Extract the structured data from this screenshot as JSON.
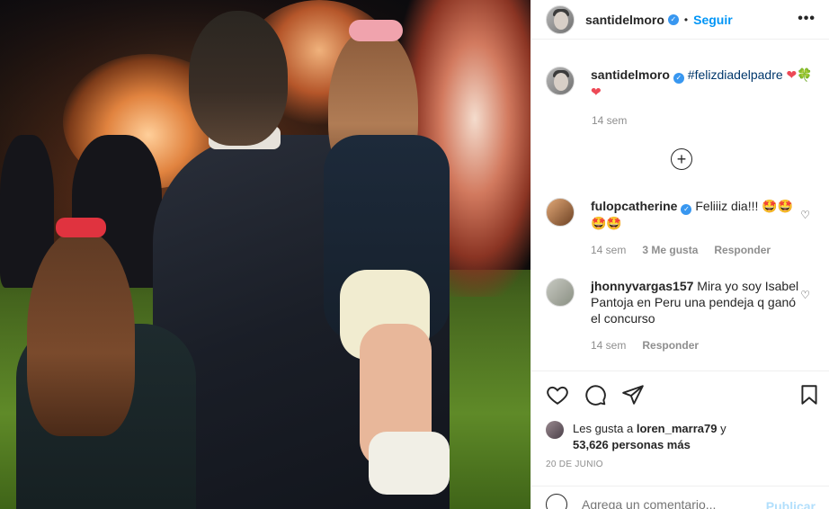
{
  "header": {
    "username": "santidelmoro",
    "separator": "•",
    "follow_label": "Seguir",
    "more_label": "•••"
  },
  "caption": {
    "username": "santidelmoro",
    "hashtag": "#felizdiadelpadre",
    "emoji_1": "❤",
    "emoji_2": "🍀",
    "emoji_3": "❤",
    "time": "14 sem"
  },
  "load_more": {
    "icon": "plus-circle-icon",
    "symbol": "+"
  },
  "comments": [
    {
      "username": "fulopcatherine",
      "text": "Feliiiz dia!!! 🤩🤩 🤩🤩",
      "time": "14 sem",
      "likes": "3 Me gusta",
      "reply": "Responder"
    },
    {
      "username": "jhonnyvargas157",
      "text": "Mira yo soy Isabel Pantoja en Peru una pendeja q ganó el concurso",
      "time": "14 sem",
      "reply": "Responder"
    }
  ],
  "likes": {
    "prefix": "Les gusta a ",
    "user": "loren_marra79",
    "middle": " y",
    "count": "53,626 personas más"
  },
  "date": "20 DE JUNIO",
  "add_comment": {
    "placeholder": "Agrega un comentario...",
    "publish_label": "Publicar"
  },
  "colors": {
    "accent": "#0095f6",
    "verified": "#3897f0",
    "heart": "#ed4956",
    "muted": "#8e8e8e"
  }
}
